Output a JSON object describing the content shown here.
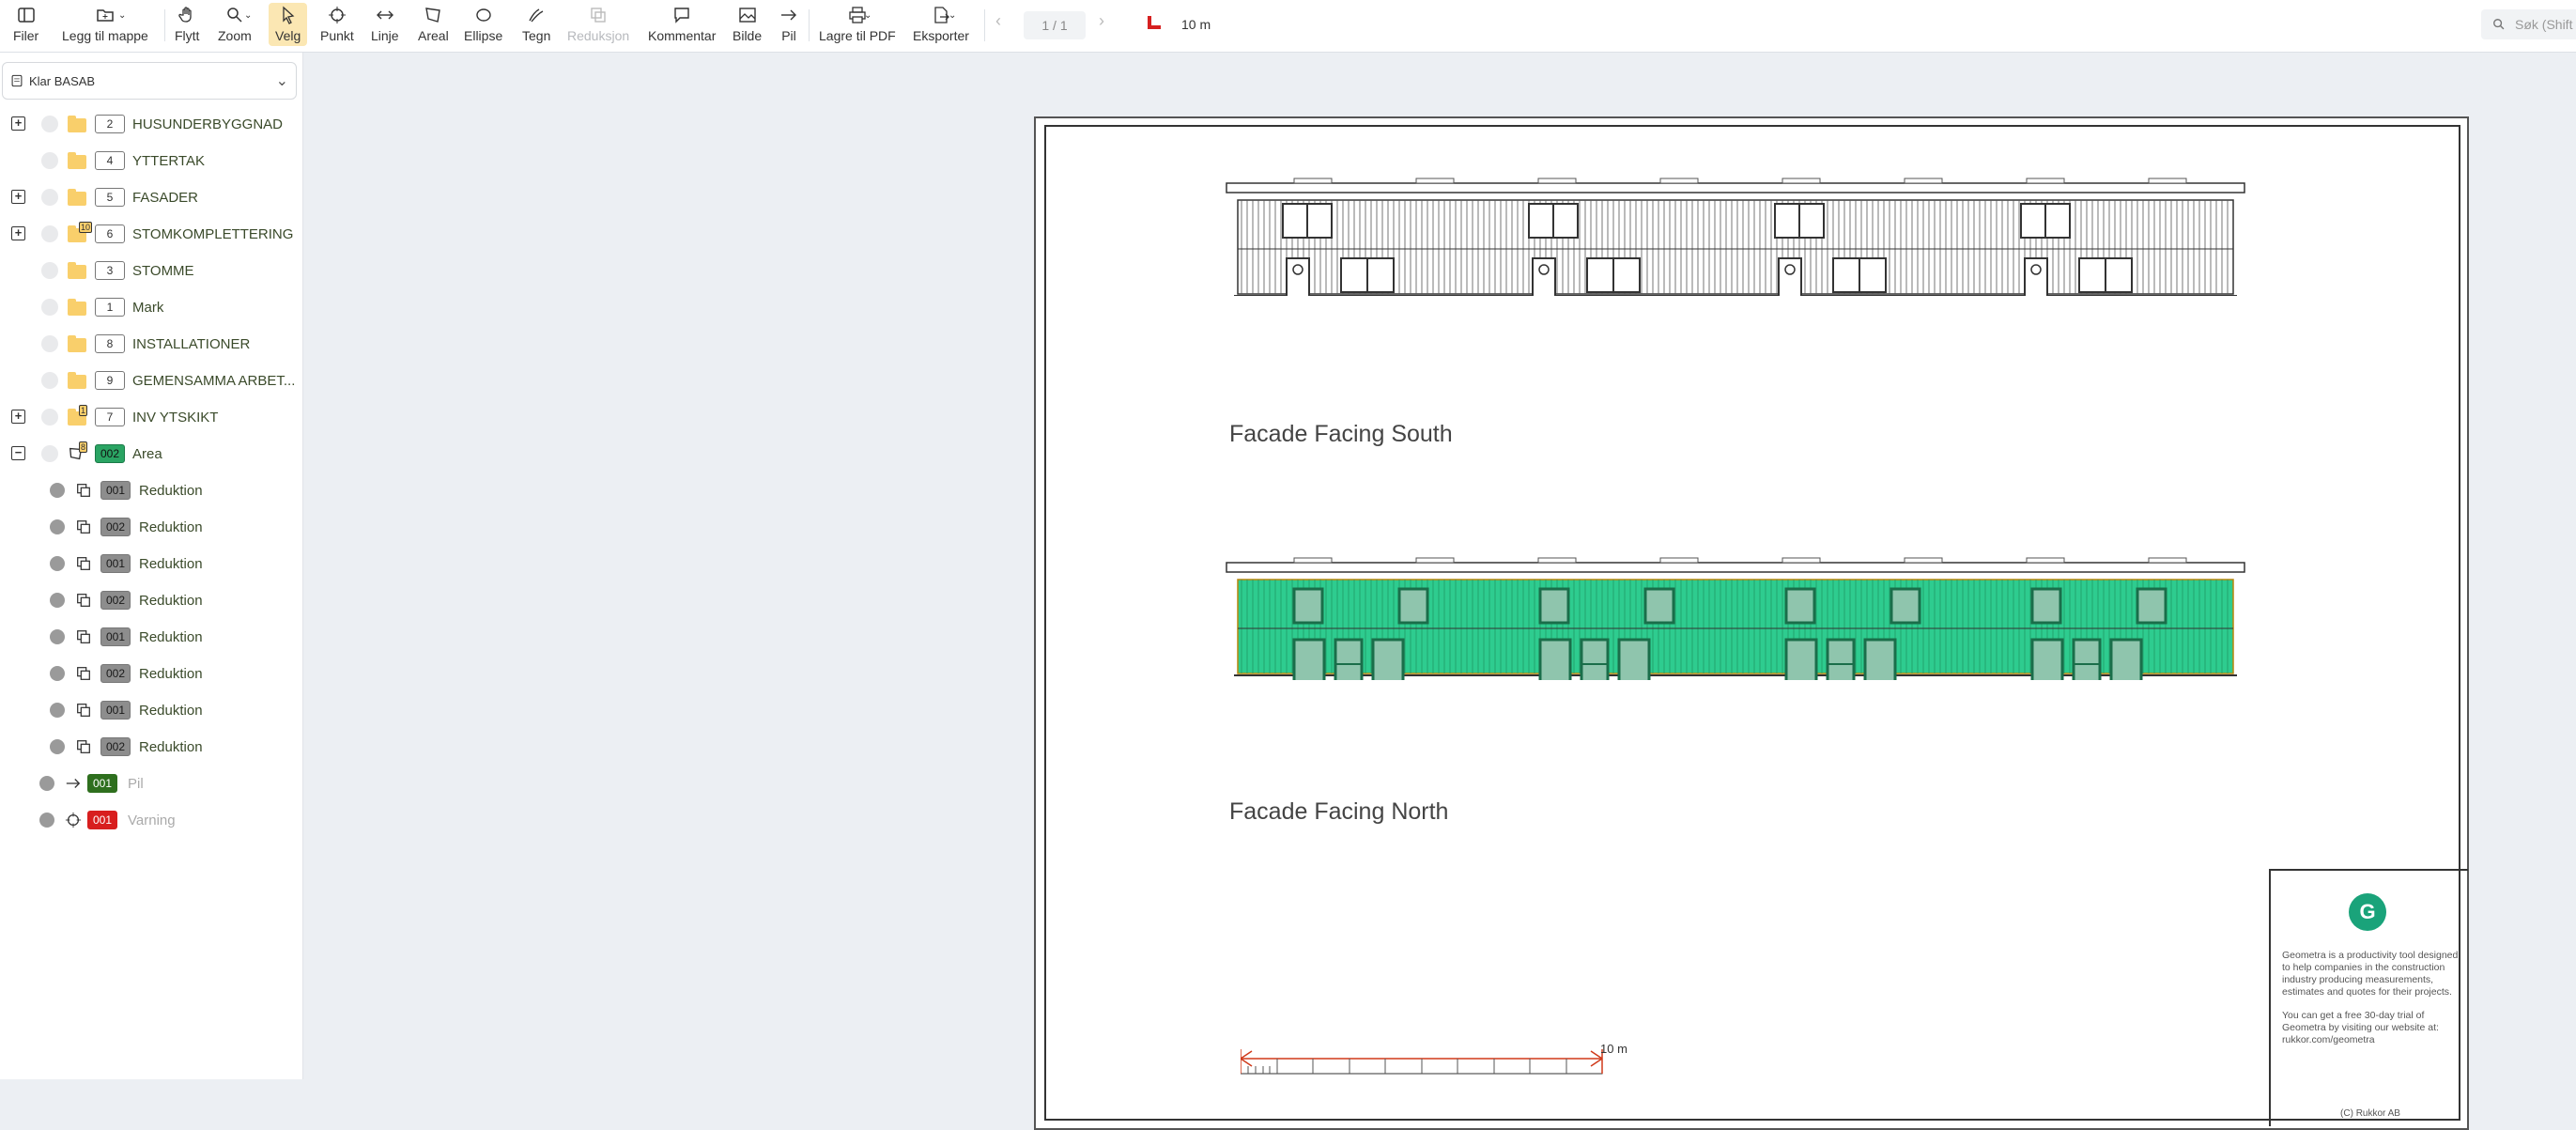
{
  "toolbar": {
    "items": [
      {
        "label": "Filer",
        "icon": "sidebar-icon"
      },
      {
        "label": "Legg til mappe",
        "icon": "folder-add-icon"
      },
      {
        "label": "Flytt",
        "icon": "hand-icon"
      },
      {
        "label": "Zoom",
        "icon": "magnifier-icon"
      },
      {
        "label": "Velg",
        "icon": "cursor-icon"
      },
      {
        "label": "Punkt",
        "icon": "crosshair-icon"
      },
      {
        "label": "Linje",
        "icon": "line-arrows-icon"
      },
      {
        "label": "Areal",
        "icon": "polygon-icon"
      },
      {
        "label": "Ellipse",
        "icon": "ellipse-icon"
      },
      {
        "label": "Tegn",
        "icon": "pen-icon"
      },
      {
        "label": "Reduksjon",
        "icon": "reduction-icon"
      },
      {
        "label": "Kommentar",
        "icon": "comment-icon"
      },
      {
        "label": "Bilde",
        "icon": "image-icon"
      },
      {
        "label": "Pil",
        "icon": "arrow-icon"
      },
      {
        "label": "Lagre til PDF",
        "icon": "printer-icon"
      },
      {
        "label": "Eksporter",
        "icon": "export-icon"
      }
    ],
    "page_indicator": "1 / 1",
    "scale_label": "10 m",
    "search_placeholder": "Søk (Shift"
  },
  "sidebar": {
    "project": "Klar BASAB",
    "layers": [
      {
        "id": "2",
        "name": "HUSUNDERBYGGNAD"
      },
      {
        "id": "4",
        "name": "YTTERTAK"
      },
      {
        "id": "5",
        "name": "FASADER"
      },
      {
        "id": "6",
        "name": "STOMKOMPLETTERING",
        "count": "10"
      },
      {
        "id": "3",
        "name": "STOMME"
      },
      {
        "id": "1",
        "name": "Mark"
      },
      {
        "id": "8",
        "name": "INSTALLATIONER"
      },
      {
        "id": "9",
        "name": "GEMENSAMMA ARBET..."
      },
      {
        "id": "7",
        "name": "INV YTSKIKT",
        "count": "1"
      },
      {
        "id": "002",
        "name": "Area",
        "count": "8"
      }
    ],
    "reductions": [
      {
        "id": "001",
        "name": "Reduktion"
      },
      {
        "id": "002",
        "name": "Reduktion"
      },
      {
        "id": "001",
        "name": "Reduktion"
      },
      {
        "id": "002",
        "name": "Reduktion"
      },
      {
        "id": "001",
        "name": "Reduktion"
      },
      {
        "id": "002",
        "name": "Reduktion"
      },
      {
        "id": "001",
        "name": "Reduktion"
      },
      {
        "id": "002",
        "name": "Reduktion"
      }
    ],
    "extras": [
      {
        "id": "001",
        "name": "Pil",
        "color": "#2e6f1e"
      },
      {
        "id": "001",
        "name": "Varning",
        "color": "#d81e1e"
      }
    ]
  },
  "drawing": {
    "south_caption": "Facade Facing South",
    "north_caption": "Facade Facing North",
    "scale_text": "10 m",
    "area_color": "#2ecc8f",
    "logo_letter": "G",
    "info_p1": "Geometra is a productivity tool designed to help companies in the construction industry producing measurements, estimates and quotes for their projects.",
    "info_p2": "You can get a free 30-day trial of Geometra by visiting our website at: rukkor.com/geometra",
    "copyright": "(C) Rukkor AB"
  }
}
